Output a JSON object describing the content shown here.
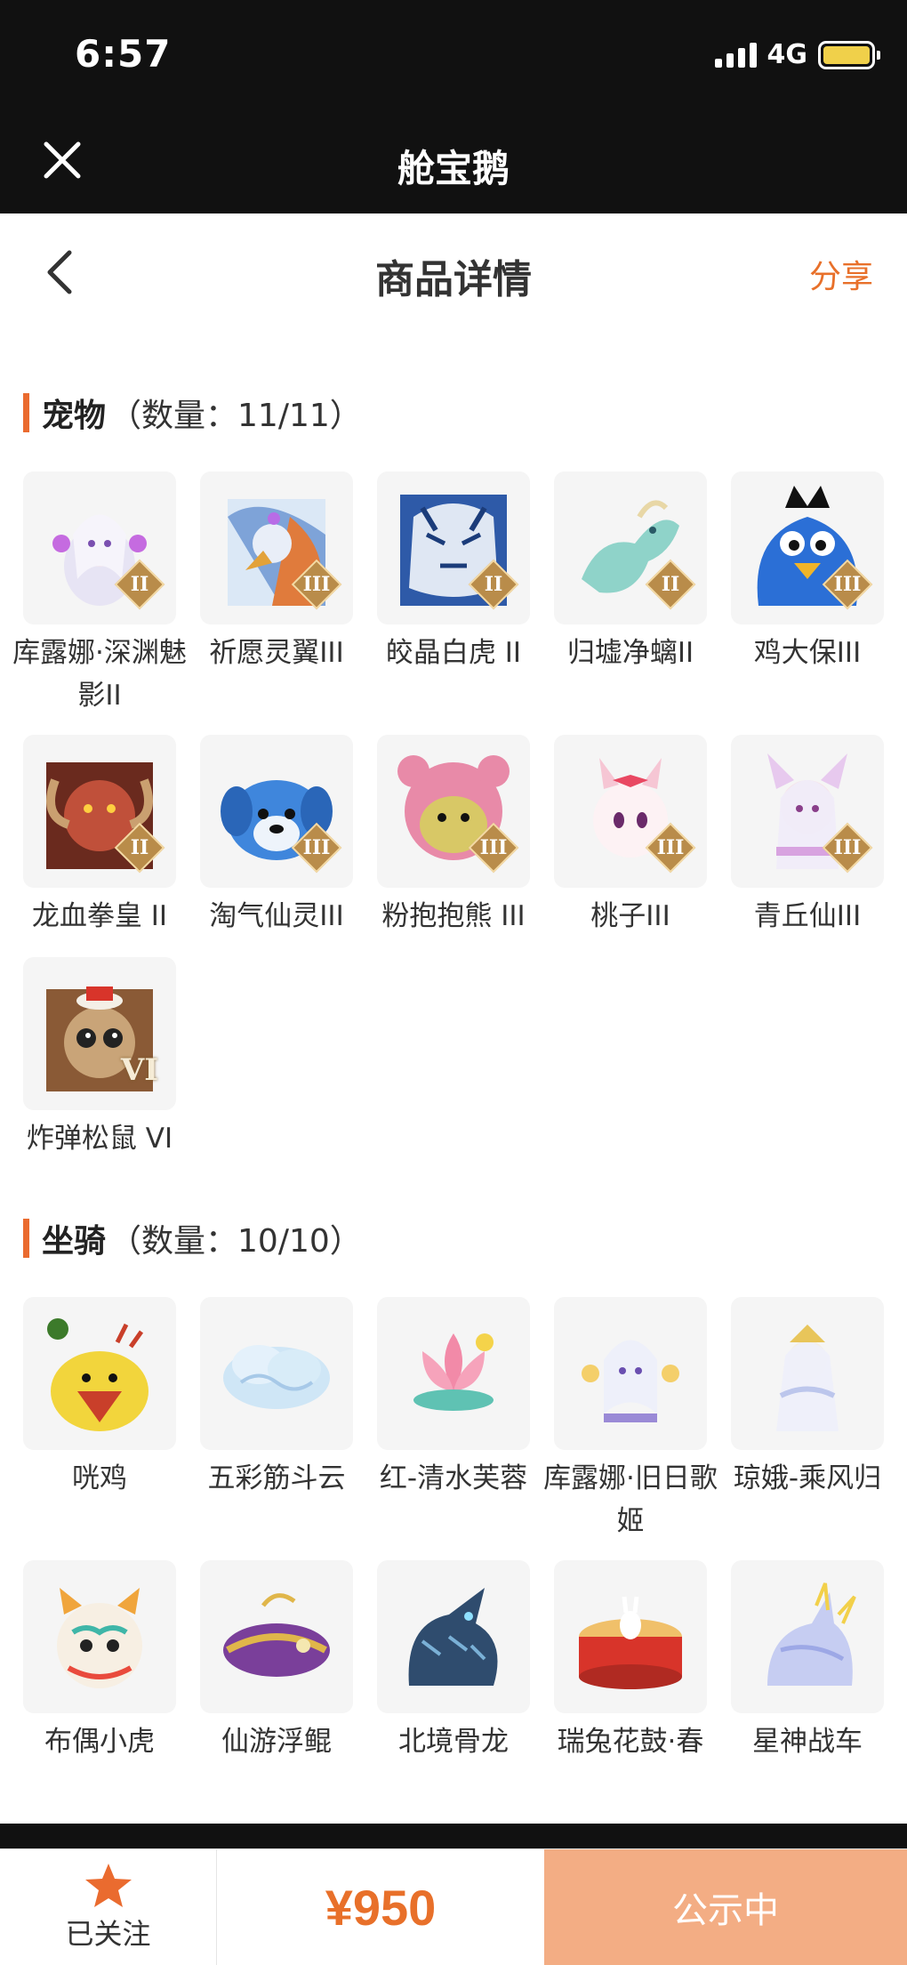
{
  "status_bar": {
    "time": "6:57",
    "network": "4G",
    "colors": {
      "battery": "#f0d04a"
    }
  },
  "app_bar": {
    "title": "舱宝鹅",
    "close_icon": "close-icon"
  },
  "header": {
    "title": "商品详情",
    "share_label": "分享",
    "back_icon": "chevron-left-icon"
  },
  "pets": {
    "label": "宠物",
    "count": "（数量：11/11）",
    "items": [
      {
        "name": "库露娜·深渊魅影II",
        "tier": "II"
      },
      {
        "name": "祈愿灵翼III",
        "tier": "III"
      },
      {
        "name": "皎晶白虎 II",
        "tier": "II"
      },
      {
        "name": "归墟净螭II",
        "tier": "II"
      },
      {
        "name": "鸡大保III",
        "tier": "III"
      },
      {
        "name": "龙血拳皇 II",
        "tier": "II"
      },
      {
        "name": "淘气仙灵III",
        "tier": "III"
      },
      {
        "name": "粉抱抱熊 III",
        "tier": "III"
      },
      {
        "name": "桃子III",
        "tier": "III"
      },
      {
        "name": "青丘仙III",
        "tier": "III"
      },
      {
        "name": "炸弹松鼠 VI",
        "tier": "VI"
      }
    ]
  },
  "mounts": {
    "label": "坐骑",
    "count": "（数量：10/10）",
    "items": [
      {
        "name": "咣鸡"
      },
      {
        "name": "五彩筋斗云"
      },
      {
        "name": "红-清水芙蓉"
      },
      {
        "name": "库露娜·旧日歌姬"
      },
      {
        "name": "琼娥-乘风归"
      },
      {
        "name": "布偶小虎"
      },
      {
        "name": "仙游浮鲲"
      },
      {
        "name": "北境骨龙"
      },
      {
        "name": "瑞兔花鼓·春"
      },
      {
        "name": "星神战车"
      }
    ]
  },
  "footer": {
    "follow_label": "已关注",
    "follow_icon": "star-icon",
    "price": "¥950",
    "status_label": "公示中",
    "colors": {
      "accent": "#e8702a",
      "status_bg": "#f3ad84"
    }
  }
}
